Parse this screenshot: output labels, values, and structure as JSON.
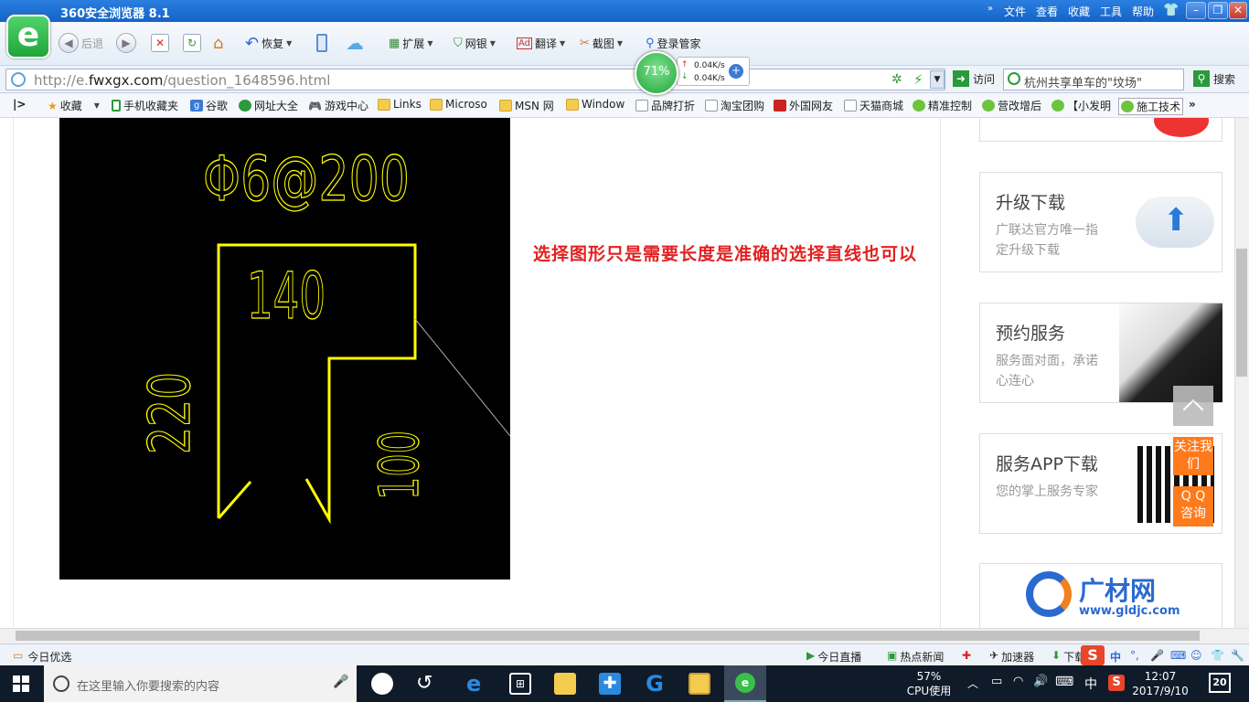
{
  "browser": {
    "title": "360安全浏览器 8.1",
    "menu": [
      "文件",
      "查看",
      "收藏",
      "工具",
      "帮助"
    ],
    "toolbar": {
      "back": "后退",
      "restore": "恢复",
      "extend": "扩展",
      "bank": "网银",
      "translate": "翻译",
      "screenshot": "截图",
      "login": "登录管家"
    },
    "address": {
      "url_prefix": "http://e.",
      "url_domain": "fwxgx.com",
      "url_path": "/question_1648596.html",
      "visit": "访问",
      "search_text": "杭州共享单车的\"坟场\"",
      "search_button": "搜索"
    },
    "speed": {
      "percent": "71%",
      "up": "0.04K/s",
      "down": "0.04K/s"
    },
    "bookmarks": [
      "收藏",
      "手机收藏夹",
      "谷歌",
      "网址大全",
      "游戏中心",
      "Links",
      "Microso",
      "MSN 网",
      "Window",
      "品牌打折",
      "淘宝团购",
      "外国网友",
      "天猫商城",
      "精准控制",
      "营改增后",
      "【小发明",
      "施工技术"
    ]
  },
  "content": {
    "cad": {
      "spec": "Φ6@200",
      "dim_top": "140",
      "dim_left": "220",
      "dim_right": "100"
    },
    "note": "选择图形只是需要长度是准确的选择直线也可以",
    "sidebar": [
      {
        "title": "升级下载",
        "desc": "广联达官方唯一指定升级下载"
      },
      {
        "title": "预约服务",
        "desc": "服务面对面，承诺心连心"
      },
      {
        "title": "服务APP下载",
        "desc": "您的掌上服务专家"
      }
    ],
    "follow_us": "关注我们",
    "qq": "Q Q 咨询",
    "logo_name": "广材网",
    "logo_url": "www.gldjc.com"
  },
  "statusbar": {
    "left": "今日优选",
    "items": [
      "今日直播",
      "热点新闻",
      "加速器",
      "下载"
    ],
    "ime": "中"
  },
  "taskbar": {
    "search_placeholder": "在这里输入你要搜索的内容",
    "cpu_percent": "57%",
    "cpu_label": "CPU使用",
    "ime": "中",
    "time": "12:07",
    "date": "2017/9/10",
    "notifications": "20"
  }
}
